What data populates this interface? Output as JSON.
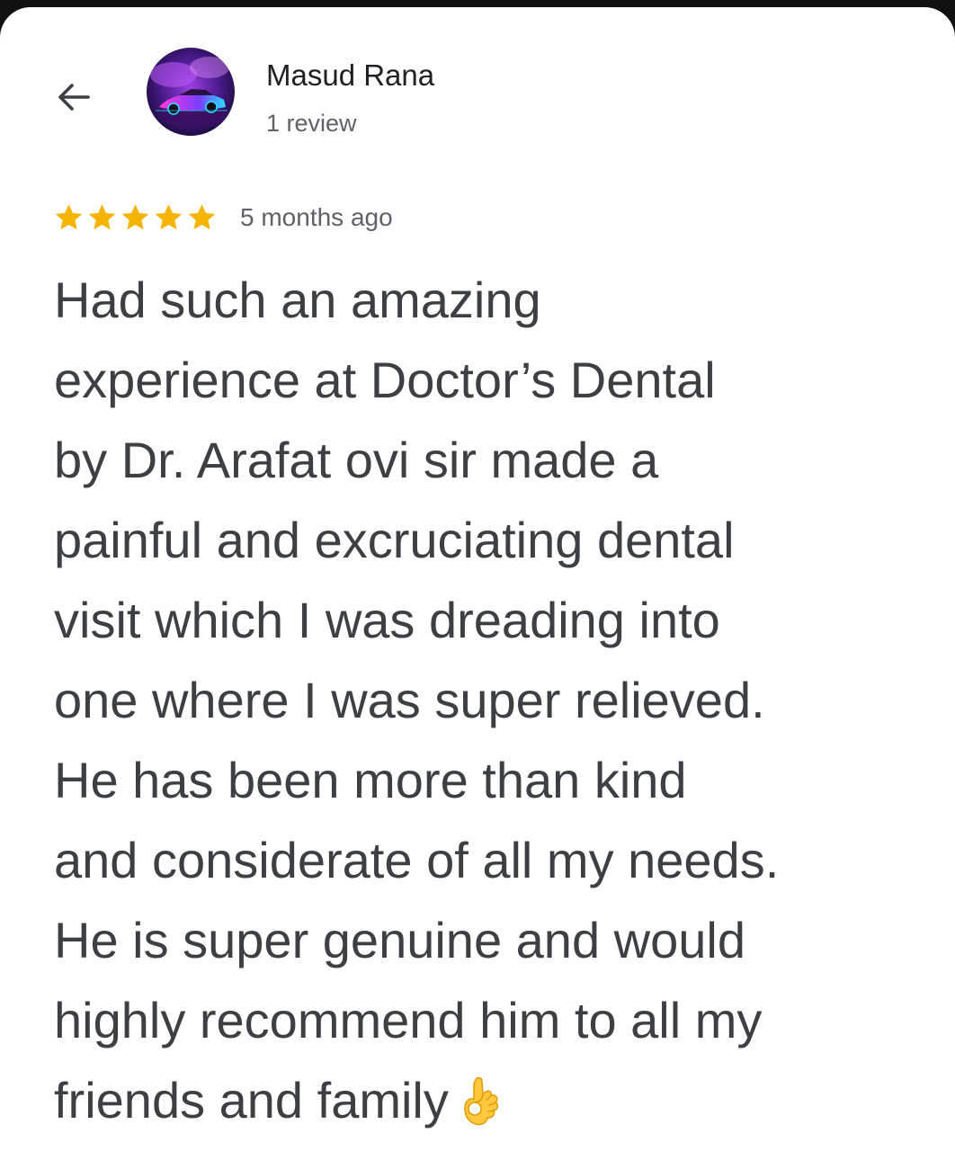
{
  "reviewer": {
    "name": "Masud Rana",
    "review_count": "1 review",
    "avatar_icon": "neon-sports-car-avatar"
  },
  "header": {
    "back_icon": "arrow-left-icon"
  },
  "rating": {
    "stars": 5,
    "max_stars": 5,
    "star_color": "#F4B400",
    "time_ago": "5 months ago"
  },
  "review": {
    "lines": [
      "Had such an amazing",
      "experience at Doctor’s Dental",
      "by Dr. Arafat ovi sir made a",
      "painful and excruciating dental",
      "visit which I was dreading into",
      "one where I was super relieved.",
      "He has been more than kind",
      "and considerate of all my needs.",
      "He is super genuine and would",
      "highly recommend him to all my",
      "friends and family"
    ],
    "trailing_emoji": "ok-hand-emoji"
  },
  "colors": {
    "text_primary": "#202124",
    "text_body": "#3c4043",
    "text_secondary": "#5f6368"
  }
}
